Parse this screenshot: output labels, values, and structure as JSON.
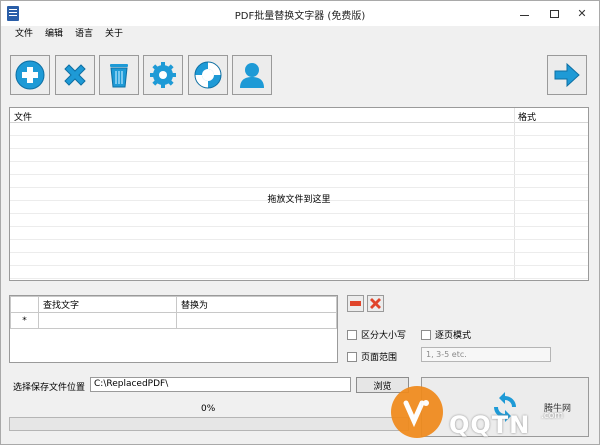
{
  "window": {
    "title": "PDF批量替换文字器 (免费版)",
    "controls": {
      "minimize": "—",
      "maximize": "□",
      "close": "✕"
    }
  },
  "menu": [
    "文件",
    "编辑",
    "语言",
    "关于"
  ],
  "toolbar": {
    "buttons": [
      {
        "icon": "add-icon"
      },
      {
        "icon": "remove-icon"
      },
      {
        "icon": "clear-icon"
      },
      {
        "icon": "settings-icon"
      },
      {
        "icon": "help-icon"
      },
      {
        "icon": "user-icon"
      }
    ],
    "next_icon": "arrow-right-icon"
  },
  "file_list": {
    "columns": [
      "文件",
      "格式"
    ],
    "drop_hint": "拖放文件到这里",
    "rows": []
  },
  "replace_grid": {
    "columns": [
      "查找文字",
      "替换为"
    ],
    "new_row_marker": "*"
  },
  "options": {
    "case_sensitive": "区分大小写",
    "page_mode": "逐页模式",
    "page_range": "页面范围",
    "page_range_placeholder": "1, 3-5 etc."
  },
  "save": {
    "label": "选择保存文件位置",
    "path": "C:\\ReplacedPDF\\",
    "browse": "浏览"
  },
  "progress": {
    "text": "0%",
    "value": 0
  },
  "watermark": {
    "text": "QQTN",
    "suffix": ".com",
    "brand": "腾牛网"
  },
  "colors": {
    "accent_blue": "#1e9ad6",
    "remove_red": "#e0452b",
    "brand_orange": "#f08a1c"
  }
}
